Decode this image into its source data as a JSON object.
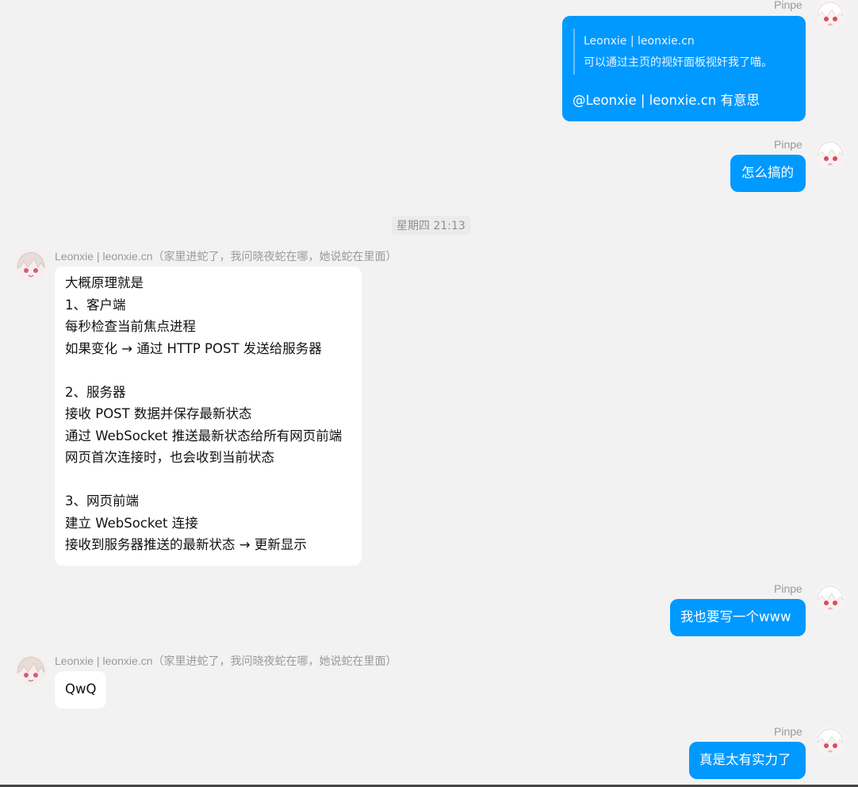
{
  "users": {
    "me": "Pinpe",
    "other": "Leonxie | leonxie.cn（家里进蛇了，我问晓夜蛇在哪，她说蛇在里面）"
  },
  "quote": {
    "name": "Leonxie | leonxie.cn",
    "text": "可以通过主页的视奸面板视奸我了喵。"
  },
  "messages": {
    "m1": "@Leonxie | leonxie.cn 有意思",
    "m2": "怎么搞的",
    "m3_lines": [
      "大概原理就是",
      "1、客户端",
      "每秒检查当前焦点进程",
      "如果变化 → 通过 HTTP POST 发送给服务器",
      "",
      "2、服务器",
      "接收 POST 数据并保存最新状态",
      "通过 WebSocket 推送最新状态给所有网页前端",
      "网页首次连接时，也会收到当前状态",
      "",
      "3、网页前端",
      "建立 WebSocket 连接",
      "接收到服务器推送的最新状态 → 更新显示"
    ],
    "m4": "我也要写一个www",
    "m5": "QwQ",
    "m6": "真是太有实力了"
  },
  "timestamp": "星期四 21:13",
  "icons": {
    "my_avatar": "anime-avatar-white-hair-icon",
    "other_avatar": "anime-avatar-pink-hair-icon"
  },
  "colors": {
    "background": "#f2f2f2",
    "outgoing_bubble": "#0099ff",
    "incoming_bubble": "#ffffff"
  }
}
